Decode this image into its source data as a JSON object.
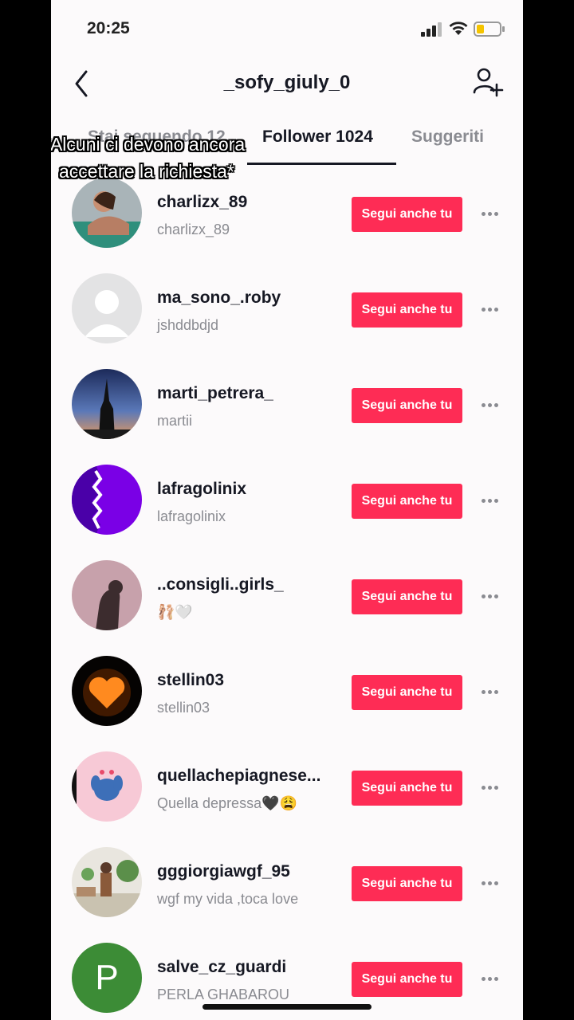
{
  "status": {
    "time": "20:25"
  },
  "header": {
    "title": "_sofy_giuly_0"
  },
  "tabs": [
    {
      "label": "Stai seguendo 12"
    },
    {
      "label": "Follower 1024"
    },
    {
      "label": "Suggeriti"
    }
  ],
  "overlay": {
    "line1": "*Alcuni ci devono ancora",
    "line2": "accettare la richiesta*"
  },
  "follow_label": "Segui anche tu",
  "users": [
    {
      "username": "charlizx_89",
      "nickname": "charlizx_89",
      "avatar": "photo-avatar"
    },
    {
      "username": "ma_sono_.roby",
      "nickname": "jshddbdjd",
      "avatar": "default-avatar"
    },
    {
      "username": "marti_petrera_",
      "nickname": "martii",
      "avatar": "photo-avatar"
    },
    {
      "username": "lafragolinix",
      "nickname": "lafragolinix",
      "avatar": "photo-avatar"
    },
    {
      "username": "..consigli..girls_",
      "nickname": "🩰🤍",
      "avatar": "photo-avatar"
    },
    {
      "username": "stellin03",
      "nickname": "stellin03",
      "avatar": "heart-avatar"
    },
    {
      "username": "quellachepiagnese...",
      "nickname": "Quella depressa🖤😩",
      "avatar": "photo-avatar"
    },
    {
      "username": "gggiorgiawgf_95",
      "nickname": "wgf my vida ,toca love",
      "avatar": "photo-avatar"
    },
    {
      "username": "salve_cz_guardi",
      "nickname": "PERLA GHABAROU",
      "avatar": "letter-avatar",
      "letter": "P"
    }
  ]
}
